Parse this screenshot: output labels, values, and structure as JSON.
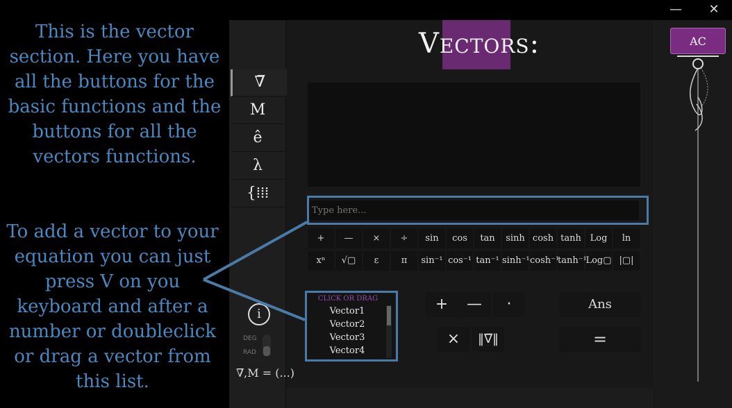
{
  "window": {
    "minimize_icon": "minus-icon",
    "close_label": "✕",
    "minimize_label": "—"
  },
  "notes": {
    "top": [
      "This is the vector",
      "section. Here you have",
      "all the buttons for the",
      "basic functions and the",
      "buttons for all the",
      "vectors functions."
    ],
    "bottom": [
      "To add a vector to your",
      "equation you can just",
      "press V on you",
      "keyboard and after a",
      "number or doubleclick",
      "or drag a vector from",
      "this list."
    ]
  },
  "sidebar": {
    "items": [
      {
        "label": "∇̅",
        "name": "vector"
      },
      {
        "label": "M",
        "name": "matrix"
      },
      {
        "label": "ê",
        "name": "complex"
      },
      {
        "label": "λ",
        "name": "lambda"
      },
      {
        "label": "{⁞⁞⁞",
        "name": "grid"
      }
    ],
    "info_label": "i",
    "deg_label": "DEG",
    "rad_label": "RAD"
  },
  "header": {
    "title": "Vectors:"
  },
  "input": {
    "placeholder": "Type here..."
  },
  "fn_row1": [
    "+",
    "—",
    "×",
    "÷",
    "sin",
    "cos",
    "tan",
    "sinh",
    "cosh",
    "tanh",
    "Log",
    "ln"
  ],
  "fn_row2": [
    "xⁿ",
    "√▢",
    "ε",
    "π",
    "sin⁻¹",
    "cos⁻¹",
    "tan⁻¹",
    "sinh⁻¹",
    "cosh⁻¹",
    "tanh⁻¹",
    "Log▢",
    "|▢|"
  ],
  "vector_list": {
    "header": "CLICK OR DRAG",
    "items": [
      "Vector1",
      "Vector2",
      "Vector3",
      "Vector4"
    ]
  },
  "vector_ops": {
    "plus": "+",
    "minus": "—",
    "dot": "·",
    "cross": "×",
    "norm": "‖∇̅‖"
  },
  "ans_label": "Ans",
  "equals_label": "=",
  "ac_label": "AC",
  "formula": "∇̅,M = (...)",
  "colors": {
    "accent": "#7a2d80",
    "annotation": "#4a88c0"
  }
}
